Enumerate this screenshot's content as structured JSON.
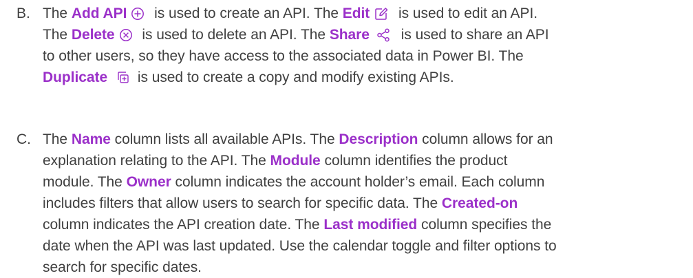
{
  "items": {
    "b": {
      "marker": "B.",
      "l1": {
        "t1": "The ",
        "k1": "Add API",
        "t2": " is used to create an API. The ",
        "k2": "Edit",
        "t3": " is used to edit an API."
      },
      "l2": {
        "t1": "The ",
        "k1": "Delete",
        "t2": " is used to delete an API. The ",
        "k2": "Share",
        "t3": " is used to share an API"
      },
      "l3": {
        "t1": "to other users, so they have access to the associated data in Power BI. The"
      },
      "l4": {
        "k1": "Duplicate",
        "t1": " is used to create a copy and modify existing APIs."
      }
    },
    "c": {
      "marker": "C.",
      "l1": {
        "t1": "The ",
        "k1": "Name",
        "t2": " column lists all available APIs. The ",
        "k2": "Description",
        "t3": " column allows for an"
      },
      "l2": {
        "t1": "explanation relating to the API. The ",
        "k1": "Module",
        "t2": " column identifies the product"
      },
      "l3": {
        "t1": "module. The ",
        "k1": "Owner",
        "t2": " column indicates the account holder’s email. Each column"
      },
      "l4": {
        "t1": "includes filters that allow users to search for specific data. The ",
        "k1": "Created-on"
      },
      "l5": {
        "t1": "column indicates the API creation date. The ",
        "k1": "Last modified",
        "t2": " column specifies the"
      },
      "l6": {
        "t1": "date when the API was last updated. Use the calendar toggle and filter options to"
      },
      "l7": {
        "t1": "search for specific dates."
      }
    }
  },
  "icons": {
    "add": "plus-circle-icon",
    "edit": "edit-pencil-icon",
    "delete": "x-circle-icon",
    "share": "share-nodes-icon",
    "duplicate": "duplicate-copy-icon"
  },
  "colors": {
    "keyword": "#9b30c9",
    "text": "#404040"
  }
}
